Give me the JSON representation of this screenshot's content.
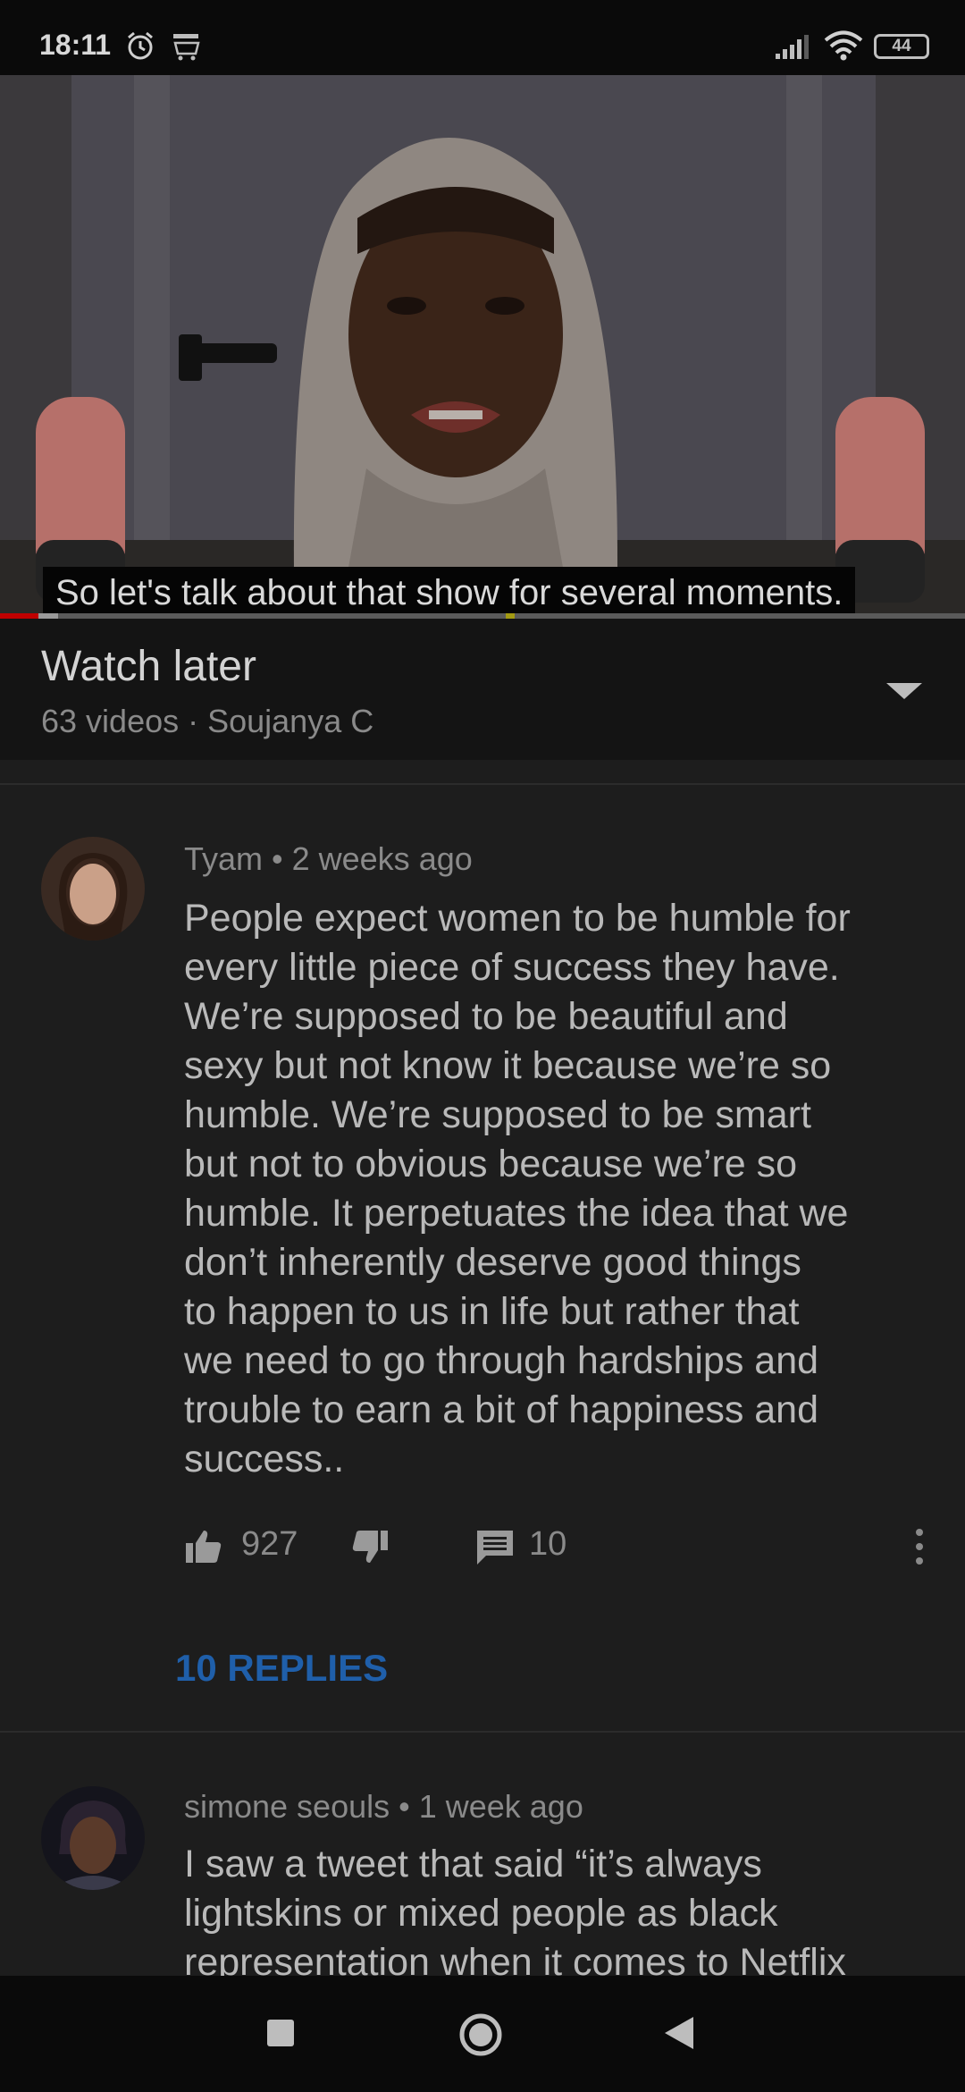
{
  "status_bar": {
    "time": "18:11",
    "battery": "44",
    "icons": [
      "alarm-icon",
      "amazon-icon",
      "signal-icon",
      "wifi-icon",
      "battery-icon"
    ]
  },
  "video": {
    "caption": "So let's talk about that show for several moments.",
    "progress_played_percent": 4,
    "progress_buffered_percent": 6
  },
  "playlist": {
    "title": "Watch later",
    "meta": "63 videos · Soujanya C"
  },
  "comments": [
    {
      "author": "Tyam",
      "time": "2 weeks ago",
      "meta": "Tyam • 2 weeks ago",
      "lines": [
        "People expect women to be humble for",
        "every little piece of success they have.",
        "We’re supposed to be beautiful and",
        "sexy but not know it because we’re so",
        "humble. We’re supposed to be smart",
        "but not to obvious because we’re so",
        "humble. It perpetuates the idea that we",
        "don’t inherently deserve good things",
        "to happen to us in life but rather that",
        "we need to go through hardships and",
        "trouble to earn a bit of happiness and",
        "success.."
      ],
      "likes": "927",
      "reply_count": "10",
      "replies_label": "10 REPLIES"
    },
    {
      "author": "simone seouls",
      "time": "1 week ago",
      "meta": "simone seouls • 1 week ago",
      "lines": [
        "I saw a tweet that said “it’s always",
        "lightskins or mixed people as black",
        "representation when it comes to Netflix"
      ]
    }
  ],
  "colors": {
    "background": "#1d1d1d",
    "header_background": "#141414",
    "replies_link": "#1f5faa",
    "progress_played": "#c00000"
  }
}
